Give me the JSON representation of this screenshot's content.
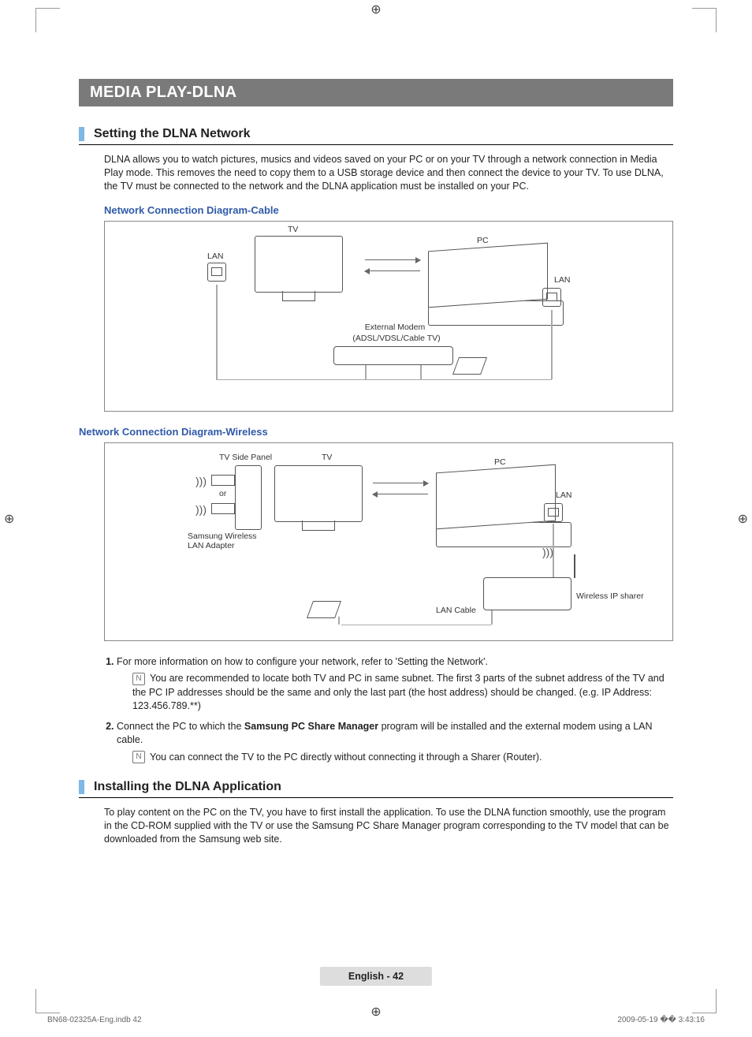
{
  "banner": "MEDIA PLAY-DLNA",
  "section1": {
    "heading": "Setting the DLNA Network",
    "intro": "DLNA allows you to watch pictures, musics and videos saved on your PC or on your TV through a network connection in Media Play mode. This removes the need to copy them to a USB storage device and then connect the device to your TV. To use DLNA, the TV must be connected to the network and the DLNA application must be installed on your PC."
  },
  "diagram1": {
    "title": "Network Connection Diagram-Cable",
    "labels": {
      "tv": "TV",
      "pc": "PC",
      "lan_tv": "LAN",
      "lan_pc": "LAN",
      "modem_line1": "External Modem",
      "modem_line2": "(ADSL/VDSL/Cable TV)"
    }
  },
  "diagram2": {
    "title": "Network Connection Diagram-Wireless",
    "labels": {
      "tv_panel": "TV Side Panel",
      "tv": "TV",
      "pc": "PC",
      "lan_pc": "LAN",
      "or": "or",
      "adapter_line1": "Samsung Wireless",
      "adapter_line2": "LAN Adapter",
      "lan_cable": "LAN Cable",
      "router": "Wireless IP sharer"
    }
  },
  "notes": {
    "item1_text": "For more information on how to configure your network, refer to 'Setting the Network'.",
    "item1_sub": "You are recommended to locate both TV and PC in same subnet. The first 3 parts of the subnet address of the TV and the PC IP addresses should be the same and only the last part (the host address) should be changed. (e.g. IP Address: 123.456.789.**)",
    "item2_pre": "Connect the PC to which the ",
    "item2_bold": "Samsung PC Share Manager",
    "item2_post": " program will be installed and the external modem using a LAN cable.",
    "item2_sub": "You can connect the TV to the PC directly without connecting it through a Sharer (Router)."
  },
  "section2": {
    "heading": "Installing the DLNA Application",
    "intro": "To play content on the PC on the TV, you have to first install the application. To use the DLNA function smoothly, use the program in the CD-ROM supplied with the TV or use the Samsung PC Share Manager program corresponding to the TV model that can be downloaded from the Samsung web site."
  },
  "footer": "English - 42",
  "print_meta": {
    "left": "BN68-02325A-Eng.indb   42",
    "right": "2009-05-19   �� 3:43:16"
  }
}
